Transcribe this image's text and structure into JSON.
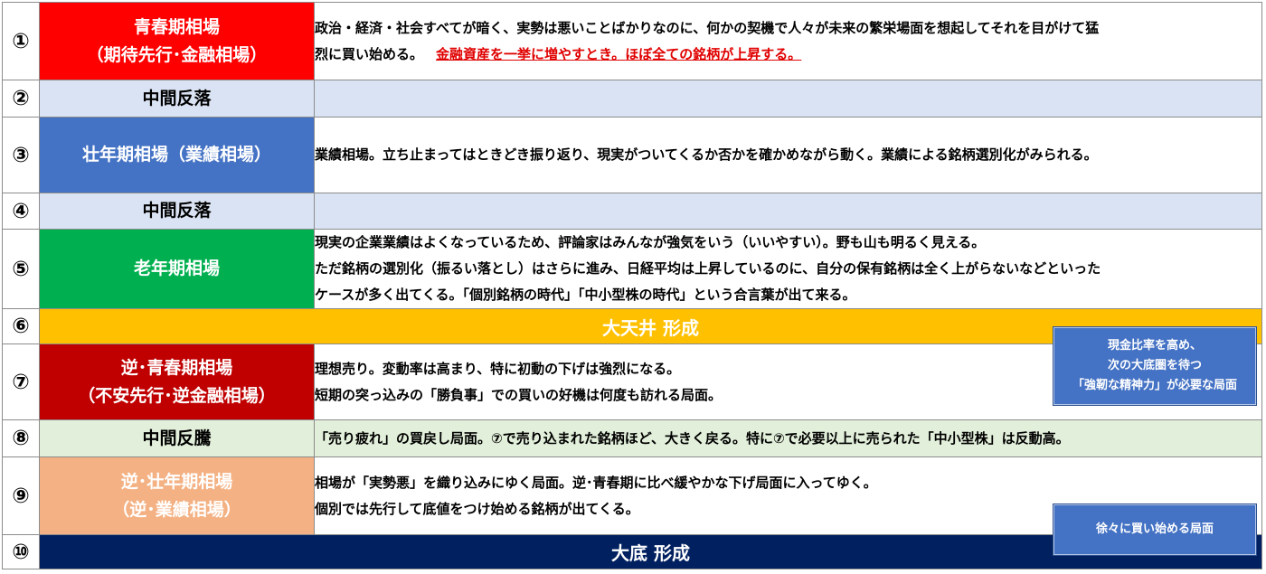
{
  "rows": [
    {
      "num": "①",
      "label1": "青春期相場",
      "label2": "（期待先行･金融相場）",
      "label_bg": "#ff0000",
      "label_color": "#ffffff",
      "desc1": "政治・経済・社会すべてが暗く、実勢は悪いことばかりなのに、何かの契機で人々が未来の繁栄場面を想起してそれを目がけて猛",
      "desc2": "烈に買い始める。",
      "desc2_red": "金融資産を一挙に増やすとき。ほぼ全ての銘柄が上昇する。"
    },
    {
      "num": "②",
      "label1": "中間反落",
      "label_bg": "#dae3f3",
      "label_color": "#000000",
      "desc_bg": "#dae3f3"
    },
    {
      "num": "③",
      "label1": "壮年期相場（業績相場）",
      "label_bg": "#4472c4",
      "label_color": "#ffffff",
      "desc1": "業績相場。立ち止まってはときどき振り返り、現実がついてくるか否かを確かめながら動く。業績による銘柄選別化がみられる。"
    },
    {
      "num": "④",
      "label1": "中間反落",
      "label_bg": "#dae3f3",
      "label_color": "#000000",
      "desc_bg": "#dae3f3"
    },
    {
      "num": "⑤",
      "label1": "老年期相場",
      "label_bg": "#00b050",
      "label_color": "#ffffff",
      "desc1": "現実の企業業績はよくなっているため、評論家はみんなが強気をいう（いいやすい）。野も山も明るく見える。",
      "desc2": "ただ銘柄の選別化（振るい落とし）はさらに進み、日経平均は上昇しているのに、自分の保有銘柄は全く上がらないなどといった",
      "desc3": "ケースが多く出てくる。「個別銘柄の時代」「中小型株の時代」という合言葉が出て来る。"
    },
    {
      "num": "⑥",
      "span": "大天井 形成",
      "span_bg": "#ffc000",
      "span_color": "#ffffff"
    },
    {
      "num": "⑦",
      "label1": "逆･青春期相場",
      "label2": "（不安先行･逆金融相場）",
      "label_bg": "#c00000",
      "label_color": "#ffffff",
      "desc1": "理想売り。変動率は高まり、特に初動の下げは強烈になる。",
      "desc2": "短期の突っ込みの「勝負事」での買いの好機は何度も訪れる局面。"
    },
    {
      "num": "⑧",
      "label1": "中間反騰",
      "label_bg": "#e2efda",
      "label_color": "#000000",
      "desc_bg": "#e2efda",
      "desc1": "「売り疲れ」の買戻し局面。⑦で売り込まれた銘柄ほど、大きく戻る。特に⑦で必要以上に売られた「中小型株」は反動高。"
    },
    {
      "num": "⑨",
      "label1": "逆･壮年期相場",
      "label2": "（逆･業績相場）",
      "label_bg": "#f4b183",
      "label_color": "#ffffff",
      "desc1": "相場が「実勢悪」を織り込みにゆく局面。逆･青春期に比べ緩やかな下げ局面に入ってゆく。",
      "desc2": "個別では先行して底値をつけ始める銘柄が出てくる。"
    },
    {
      "num": "⑩",
      "span": "大底 形成",
      "span_bg": "#002060",
      "span_color": "#ffffff"
    }
  ],
  "callouts": [
    {
      "line1": "現金比率を高め、",
      "line2": "次の大底圏を待つ",
      "line3": "「強靭な精神力」が必要な局面",
      "bg": "#4472c4"
    },
    {
      "line1": "徐々に買い始める局面",
      "bg": "#4472c4"
    }
  ]
}
